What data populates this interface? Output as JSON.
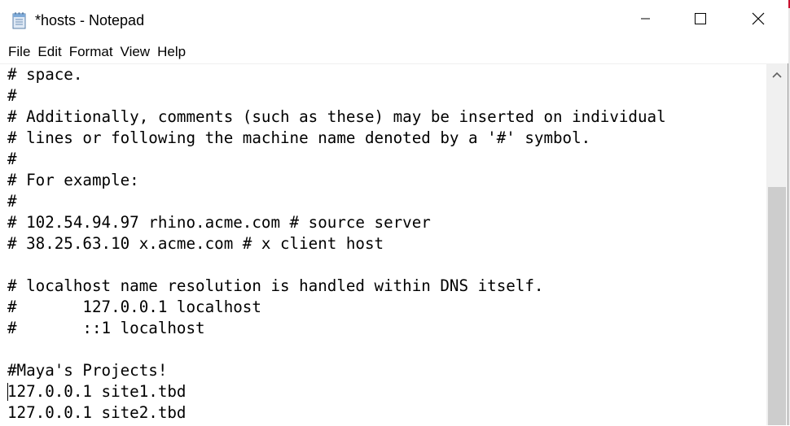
{
  "window": {
    "title": "*hosts - Notepad",
    "app_icon": "notepad-icon"
  },
  "controls": {
    "minimize_icon": "minimize-icon",
    "maximize_icon": "maximize-icon",
    "close_icon": "close-icon"
  },
  "menu": [
    {
      "label": "File"
    },
    {
      "label": "Edit"
    },
    {
      "label": "Format"
    },
    {
      "label": "View"
    },
    {
      "label": "Help"
    }
  ],
  "editor": {
    "lines": [
      "# space.",
      "#",
      "# Additionally, comments (such as these) may be inserted on individual",
      "# lines or following the machine name denoted by a '#' symbol.",
      "#",
      "# For example:",
      "#",
      "# 102.54.94.97 rhino.acme.com # source server",
      "# 38.25.63.10 x.acme.com # x client host",
      "",
      "# localhost name resolution is handled within DNS itself.",
      "#       127.0.0.1 localhost",
      "#       ::1 localhost",
      "",
      "#Maya's Projects!",
      "127.0.0.1 site1.tbd",
      "127.0.0.1 site2.tbd"
    ],
    "caret_line": 15
  },
  "scrollbar": {
    "up_icon": "chevron-up-icon",
    "thumb_position_fraction": 0.34
  }
}
